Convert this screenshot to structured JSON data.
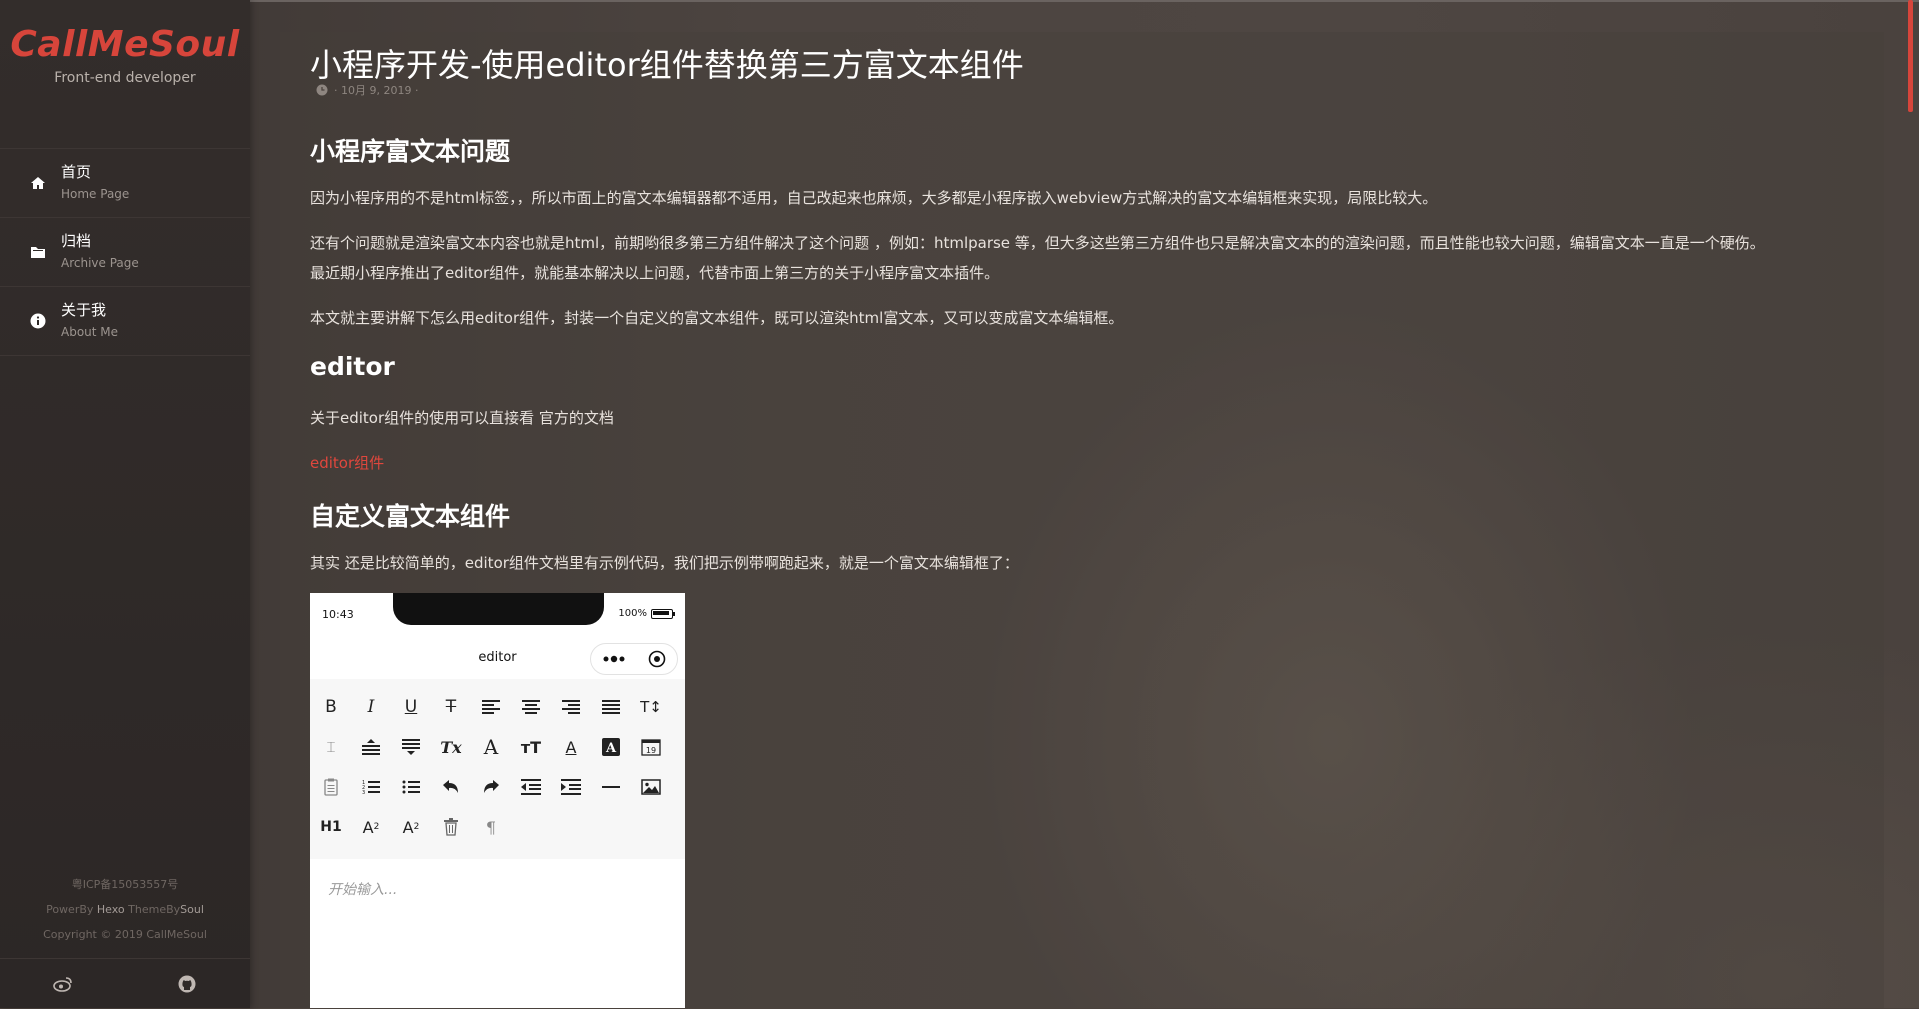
{
  "sidebar": {
    "logo": "CallMeSoul",
    "tagline": "Front-end developer",
    "items": [
      {
        "label": "首页",
        "sub": "Home Page"
      },
      {
        "label": "归档",
        "sub": "Archive Page"
      },
      {
        "label": "关于我",
        "sub": "About Me"
      }
    ],
    "footer": {
      "icp": "粤ICP备15053557号",
      "power_by": "PowerBy",
      "hexo": "Hexo",
      "theme_by": "ThemeBy",
      "soul": "Soul",
      "copyright": "Copyright © 2019 CallMeSoul"
    }
  },
  "article": {
    "title": "小程序开发-使用editor组件替换第三方富文本组件",
    "date": "· 10月 9, 2019 ·",
    "h_intro": "小程序富文本问题",
    "p1": "因为小程序用的不是html标签，，所以市面上的富文本编辑器都不适用，自己改起来也麻烦，大多都是小程序嵌入webview方式解决的富文本编辑框来实现，局限比较大。",
    "p2a": "还有个问题就是渲染富文本内容也就是html，前期哟很多第三方组件解决了这个问题 ，例如：htmlparse 等，但大多这些第三方组件也只是解决富文本的的渲染问题，而且性能也较大问题，编辑富文本一直是一个硬伤。",
    "p2b": "最近期小程序推出了editor组件，就能基本解决以上问题，代替市面上第三方的关于小程序富文本插件。",
    "p3": "本文就主要讲解下怎么用editor组件，封装一个自定义的富文本组件，既可以渲染html富文本，又可以变成富文本编辑框。",
    "h_editor": "editor",
    "p4": "关于editor组件的使用可以直接看 官方的文档",
    "link_editor": "editor组件",
    "h_custom": "自定义富文本组件",
    "p5": "其实 还是比较简单的，editor组件文档里有示例代码，我们把示例带啊跑起来，就是一个富文本编辑框了："
  },
  "phone": {
    "time": "10:43",
    "battery": "100%",
    "nav_title": "editor",
    "toolbar": [
      [
        "B",
        "I",
        "U",
        "S",
        "align-left",
        "align-center",
        "align-right",
        "align-justify",
        "T↕"
      ],
      [
        "line-height",
        "space-before",
        "space-after",
        "Tx",
        "A",
        "TT",
        "A-underline",
        "A-box",
        "19"
      ],
      [
        "clipboard",
        "ordered-list",
        "bullet-list",
        "undo",
        "redo",
        "outdent",
        "indent",
        "hr",
        "image"
      ],
      [
        "H1",
        "A2",
        "A²",
        "delete",
        "¶"
      ]
    ],
    "placeholder": "开始输入..."
  },
  "colors": {
    "accent": "#d7453b",
    "background": "#4a423d",
    "sidebar": "#2f2a28"
  }
}
